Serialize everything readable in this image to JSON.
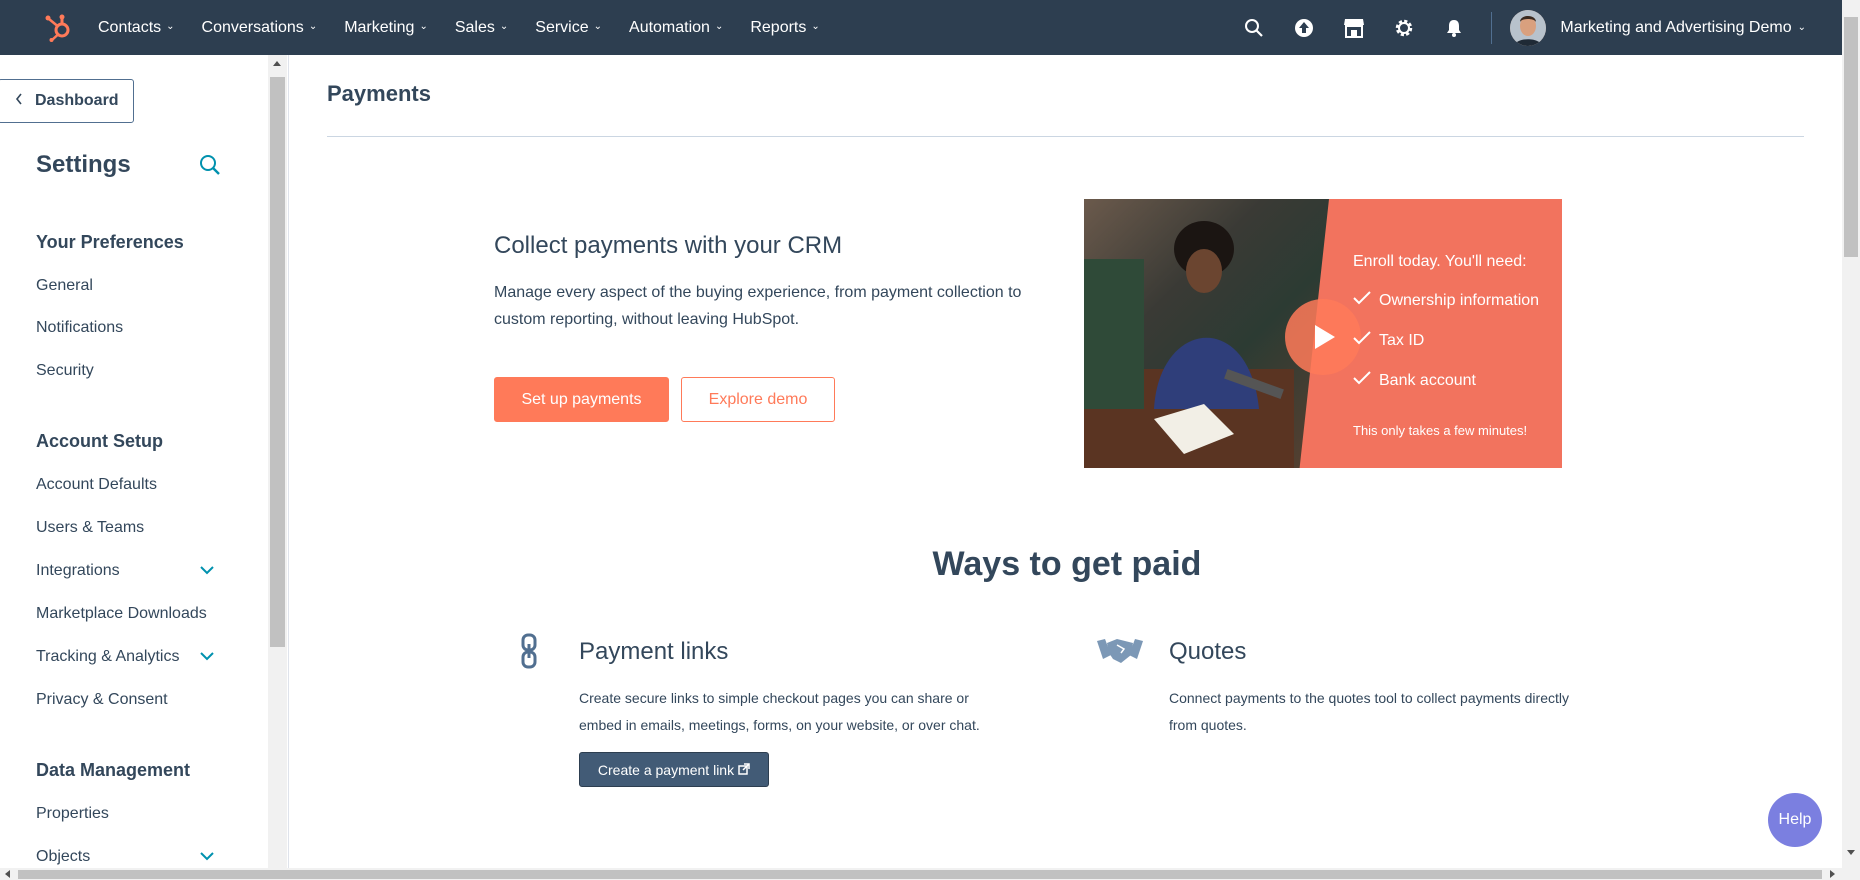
{
  "topnav": {
    "logo": "hubspot-sprocket-icon",
    "items": [
      {
        "label": "Contacts"
      },
      {
        "label": "Conversations"
      },
      {
        "label": "Marketing"
      },
      {
        "label": "Sales"
      },
      {
        "label": "Service"
      },
      {
        "label": "Automation"
      },
      {
        "label": "Reports"
      }
    ],
    "icons": [
      "search-icon",
      "upgrade-icon",
      "marketplace-icon",
      "settings-icon",
      "notifications-icon"
    ],
    "account_name": "Marketing and Advertising Demo"
  },
  "sidebar": {
    "back_label": "Dashboard",
    "title": "Settings",
    "sections": [
      {
        "title": "Your Preferences",
        "items": [
          "General",
          "Notifications",
          "Security"
        ]
      },
      {
        "title": "Account Setup",
        "items": [
          "Account Defaults",
          "Users & Teams",
          "Integrations",
          "Marketplace Downloads",
          "Tracking & Analytics",
          "Privacy & Consent"
        ]
      },
      {
        "title": "Data Management",
        "items": [
          "Properties",
          "Objects"
        ]
      }
    ]
  },
  "main": {
    "page_title": "Payments",
    "hero": {
      "title": "Collect payments with your CRM",
      "text": "Manage every aspect of the buying experience, from payment collection to custom reporting, without leaving HubSpot.",
      "primary_button": "Set up payments",
      "secondary_button": "Explore demo"
    },
    "video": {
      "enroll": "Enroll today. You'll need:",
      "items": [
        "Ownership information",
        "Tax ID",
        "Bank account"
      ],
      "footnote": "This only takes a few minutes!"
    },
    "ways_title": "Ways to get paid",
    "features": [
      {
        "icon": "link-icon",
        "title": "Payment links",
        "text": "Create secure links to simple checkout pages you can share or embed in emails, meetings, forms, on your website, or over chat.",
        "button": "Create a payment link"
      },
      {
        "icon": "handshake-icon",
        "title": "Quotes",
        "text": "Connect payments to the quotes tool to collect payments directly from quotes."
      }
    ],
    "help_label": "Help"
  },
  "colors": {
    "nav_bg": "#2d3e50",
    "accent": "#ff7a59",
    "link_teal": "#0091ae",
    "dark_button": "#425b76",
    "help": "#7b7fe0"
  }
}
